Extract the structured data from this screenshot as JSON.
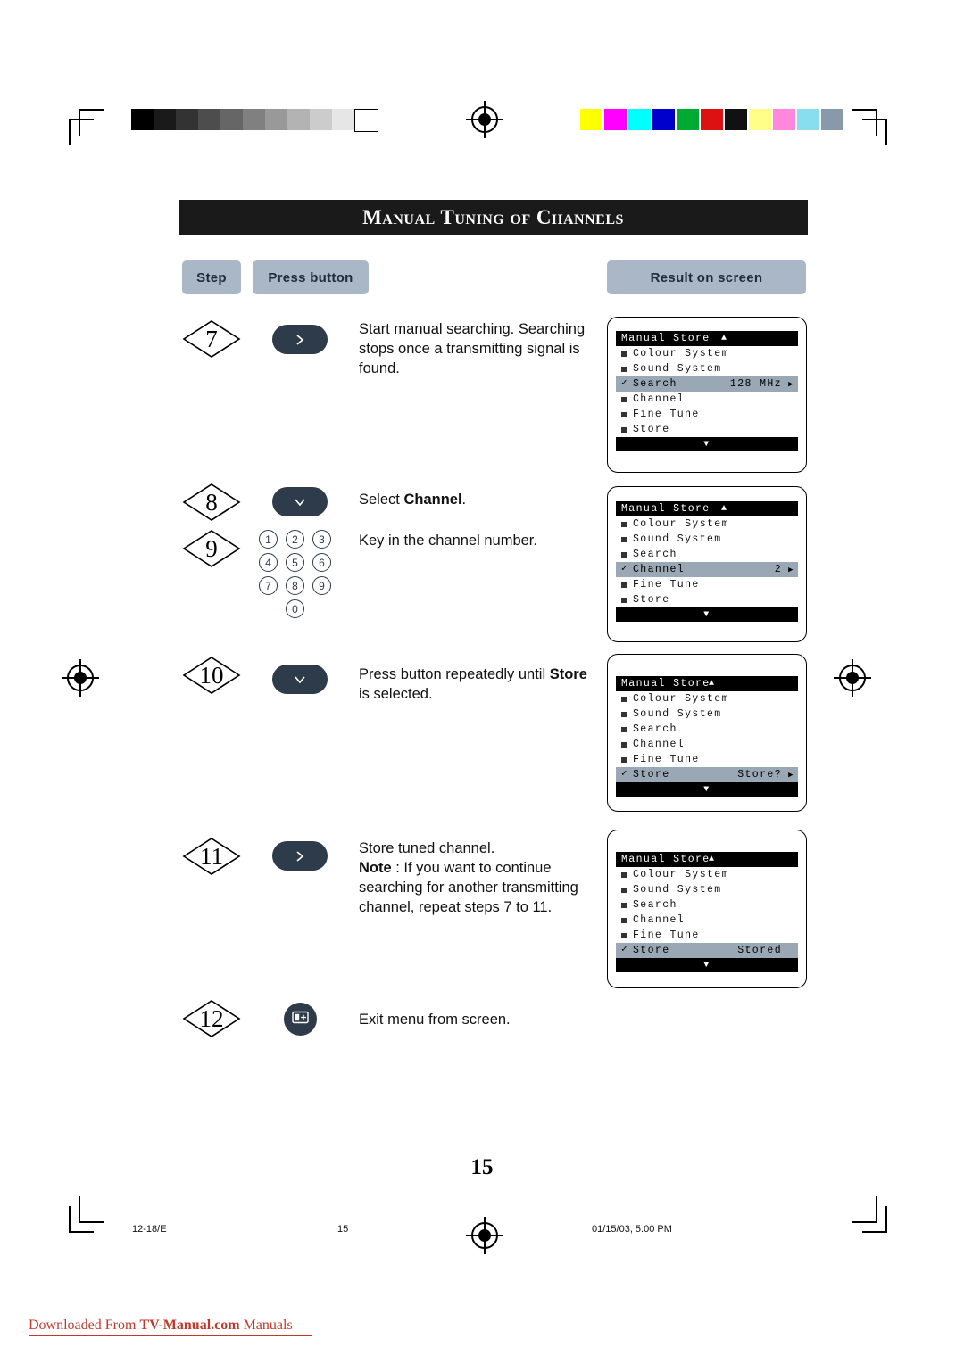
{
  "page": {
    "title": "Manual Tuning of Channels",
    "number": "15"
  },
  "headers": {
    "step": "Step",
    "press_button": "Press button",
    "result": "Result on screen"
  },
  "steps": [
    {
      "number": "7",
      "button_icon": "chevron-right-icon",
      "instruction_html": "Start manual searching. Searching stops once a transmitting signal is found.",
      "osd": {
        "title": "Manual Store",
        "title_arrow": "▲",
        "rows": [
          {
            "label": "Colour System",
            "marker": "bullet",
            "value": "",
            "arrow": "",
            "selected": false
          },
          {
            "label": "Sound System",
            "marker": "bullet",
            "value": "",
            "arrow": "",
            "selected": false
          },
          {
            "label": "Search",
            "marker": "check",
            "value": "128 MHz",
            "arrow": "▶",
            "selected": true
          },
          {
            "label": "Channel",
            "marker": "bullet",
            "value": "",
            "arrow": "",
            "selected": false
          },
          {
            "label": "Fine Tune",
            "marker": "bullet",
            "value": "",
            "arrow": "",
            "selected": false
          },
          {
            "label": "Store",
            "marker": "bullet",
            "value": "",
            "arrow": "",
            "selected": false
          }
        ],
        "footer_arrow": "▼"
      }
    },
    {
      "number": "8",
      "button_icon": "chevron-down-icon",
      "instruction_html": "Select <b>Channel</b>.",
      "osd": null
    },
    {
      "number": "9",
      "button_icon": "numeric-keypad",
      "instruction_html": "Key in the channel number.",
      "keypad": [
        "1",
        "2",
        "3",
        "4",
        "5",
        "6",
        "7",
        "8",
        "9",
        "0"
      ],
      "osd": {
        "title": "Manual Store",
        "title_arrow": "▲",
        "rows": [
          {
            "label": "Colour System",
            "marker": "bullet",
            "value": "",
            "arrow": "",
            "selected": false
          },
          {
            "label": "Sound System",
            "marker": "bullet",
            "value": "",
            "arrow": "",
            "selected": false
          },
          {
            "label": "Search",
            "marker": "bullet",
            "value": "",
            "arrow": "",
            "selected": false
          },
          {
            "label": "Channel",
            "marker": "check",
            "value": "2",
            "arrow": "▶",
            "selected": true
          },
          {
            "label": "Fine Tune",
            "marker": "bullet",
            "value": "",
            "arrow": "",
            "selected": false
          },
          {
            "label": "Store",
            "marker": "bullet",
            "value": "",
            "arrow": "",
            "selected": false
          }
        ],
        "footer_arrow": "▼"
      }
    },
    {
      "number": "10",
      "button_icon": "chevron-down-icon",
      "instruction_html": "Press button repeatedly until <b>Store</b> is selected.",
      "osd": {
        "title": "Manual Store",
        "title_arrow": "▲",
        "rows": [
          {
            "label": "Colour System",
            "marker": "bullet",
            "value": "",
            "arrow": "",
            "selected": false
          },
          {
            "label": "Sound System",
            "marker": "bullet",
            "value": "",
            "arrow": "",
            "selected": false
          },
          {
            "label": "Search",
            "marker": "bullet",
            "value": "",
            "arrow": "",
            "selected": false
          },
          {
            "label": "Channel",
            "marker": "bullet",
            "value": "",
            "arrow": "",
            "selected": false
          },
          {
            "label": "Fine Tune",
            "marker": "bullet",
            "value": "",
            "arrow": "",
            "selected": false
          },
          {
            "label": "Store",
            "marker": "check",
            "value": "Store?",
            "arrow": "▶",
            "selected": true
          }
        ],
        "footer_arrow": "▼"
      }
    },
    {
      "number": "11",
      "button_icon": "chevron-right-icon",
      "instruction_html": "Store tuned  channel.<br><b>Note</b> : If you want to continue searching for another transmitting channel, repeat steps 7 to 11.",
      "osd": {
        "title": "Manual Store",
        "title_arrow": "▲",
        "rows": [
          {
            "label": "Colour System",
            "marker": "bullet",
            "value": "",
            "arrow": "",
            "selected": false
          },
          {
            "label": "Sound System",
            "marker": "bullet",
            "value": "",
            "arrow": "",
            "selected": false
          },
          {
            "label": "Search",
            "marker": "bullet",
            "value": "",
            "arrow": "",
            "selected": false
          },
          {
            "label": "Channel",
            "marker": "bullet",
            "value": "",
            "arrow": "",
            "selected": false
          },
          {
            "label": "Fine Tune",
            "marker": "bullet",
            "value": "",
            "arrow": "",
            "selected": false
          },
          {
            "label": "Store",
            "marker": "check",
            "value": "Stored",
            "arrow": "",
            "selected": true
          }
        ],
        "footer_arrow": "▼"
      }
    },
    {
      "number": "12",
      "button_icon": "menu-exit-icon",
      "instruction_html": "Exit menu from screen.",
      "osd": null
    }
  ],
  "footer": {
    "left": "12-18/E",
    "middle": "15",
    "right": "01/15/03, 5:00 PM"
  },
  "download_note": {
    "prefix": "Downloaded From ",
    "bold": "TV-Manual.com",
    "suffix": " Manuals"
  },
  "colors": {
    "header_fill": "#a9b7c6",
    "button_fill": "#2e3b4a",
    "osd_highlight": "#9aa7b4",
    "note_red": "#c0392b",
    "title_bar": "#1a1a1a"
  },
  "calibration": {
    "grayscale": [
      "#000000",
      "#1a1a1a",
      "#333333",
      "#4d4d4d",
      "#666666",
      "#808080",
      "#999999",
      "#b3b3b3",
      "#cccccc",
      "#e6e6e6",
      "#ffffff"
    ],
    "colorbars": [
      "#ffff00",
      "#ff00ff",
      "#00ffff",
      "#0000cc",
      "#00aa33",
      "#dd1111",
      "#111111",
      "#ffff88",
      "#ff88dd",
      "#88ddee",
      "#8899aa"
    ]
  }
}
